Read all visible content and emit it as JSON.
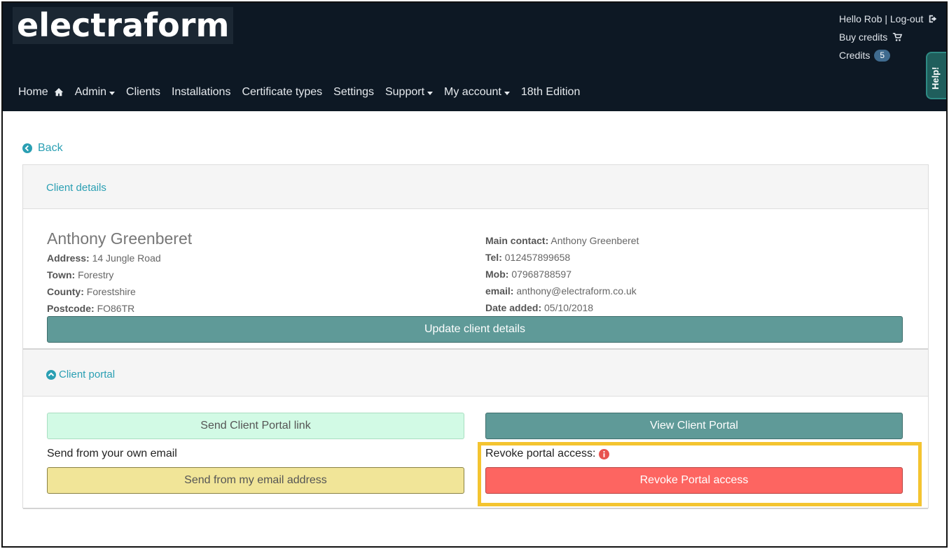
{
  "header": {
    "logo_text": "electraform",
    "user_greeting": "Hello Rob | Log-out",
    "buy_credits": "Buy credits",
    "credits_label": "Credits",
    "credits_count": "5",
    "help_tab": "Help!"
  },
  "nav": {
    "items": [
      {
        "label": "Home",
        "icon": "home-icon"
      },
      {
        "label": "Admin",
        "dropdown": true
      },
      {
        "label": "Clients"
      },
      {
        "label": "Installations"
      },
      {
        "label": "Certificate types"
      },
      {
        "label": "Settings"
      },
      {
        "label": "Support",
        "dropdown": true
      },
      {
        "label": "My account",
        "dropdown": true
      },
      {
        "label": "18th Edition"
      }
    ]
  },
  "back_label": "Back",
  "client_details": {
    "section_title": "Client details",
    "name": "Anthony Greenberet",
    "address_label": "Address:",
    "address": "14 Jungle Road",
    "town_label": "Town:",
    "town": "Forestry",
    "county_label": "County:",
    "county": "Forestshire",
    "postcode_label": "Postcode:",
    "postcode": "FO86TR",
    "main_contact_label": "Main contact:",
    "main_contact": "Anthony Greenberet",
    "tel_label": "Tel:",
    "tel": "012457899658",
    "mob_label": "Mob:",
    "mob": "07968788597",
    "email_label": "email:",
    "email": "anthony@electraform.co.uk",
    "date_added_label": "Date added:",
    "date_added": "05/10/2018",
    "update_button": "Update client details"
  },
  "client_portal": {
    "section_title": "Client portal",
    "send_link_button": "Send Client Portal link",
    "view_portal_button": "View Client Portal",
    "own_email_label": "Send from your own email",
    "send_own_email_button": "Send from my email address",
    "revoke_label": "Revoke portal access:",
    "revoke_button": "Revoke Portal access"
  },
  "colors": {
    "header_bg": "#0d1824",
    "link": "#2a9fb3",
    "teal_button": "#5f9a98",
    "mint_button": "#d2fae5",
    "yellow_button": "#f1e598",
    "red_button": "#fd6561",
    "highlight": "#f4c430"
  }
}
